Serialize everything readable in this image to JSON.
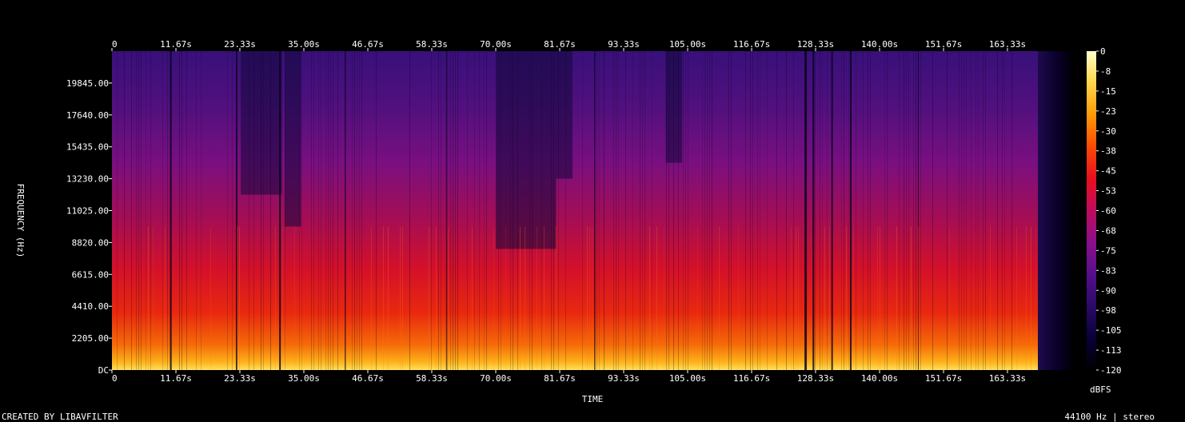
{
  "chart_data": {
    "type": "heatmap",
    "title": "",
    "xlabel": "TIME",
    "ylabel": "FREQUENCY (Hz)",
    "x_ticks": [
      "0",
      "11.67s",
      "23.33s",
      "35.00s",
      "46.67s",
      "58.33s",
      "70.00s",
      "81.67s",
      "93.33s",
      "105.00s",
      "116.67s",
      "128.33s",
      "140.00s",
      "151.67s",
      "163.33s"
    ],
    "x_tick_values": [
      0,
      11.67,
      23.33,
      35.0,
      46.67,
      58.33,
      70.0,
      81.67,
      93.33,
      105.0,
      116.67,
      128.33,
      140.0,
      151.67,
      163.33
    ],
    "xlim": [
      0,
      175
    ],
    "y_ticks": [
      "DC",
      "2205.00",
      "4410.00",
      "6615.00",
      "8820.00",
      "11025.00",
      "13230.00",
      "15435.00",
      "17640.00",
      "19845.00"
    ],
    "y_tick_values": [
      0,
      2205,
      4410,
      6615,
      8820,
      11025,
      13230,
      15435,
      17640,
      19845
    ],
    "ylim": [
      0,
      22050
    ],
    "colorbar": {
      "label": "dBFS",
      "ticks": [
        "0",
        "-8",
        "-15",
        "-23",
        "-30",
        "-38",
        "-45",
        "-53",
        "-60",
        "-68",
        "-75",
        "-83",
        "-90",
        "-98",
        "-105",
        "-113",
        "-120"
      ],
      "range": [
        -120,
        0
      ]
    },
    "colors": {
      "background": "#000000",
      "colormap": [
        "#000000",
        "#0a0038",
        "#2a0a66",
        "#560f8a",
        "#8a0f8c",
        "#bf0b5e",
        "#e80f1e",
        "#fb4a05",
        "#fd9a07",
        "#ffd54a",
        "#ffffc8"
      ]
    }
  },
  "footer": {
    "credit": "CREATED BY LIBAVFILTER",
    "info": "44100 Hz | stereo"
  }
}
